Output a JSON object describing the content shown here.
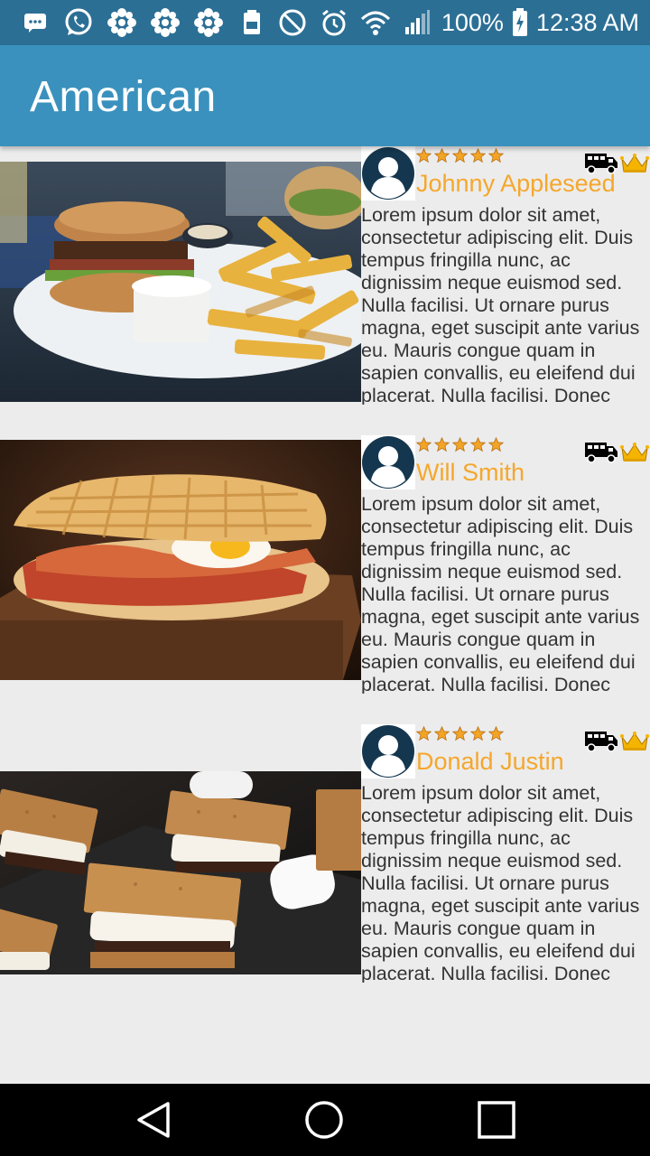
{
  "status_bar": {
    "battery_percent": "100%",
    "time": "12:38 AM",
    "left_icons": [
      "message-icon",
      "whatsapp-icon",
      "cbc-icon",
      "cbc-icon",
      "cbc-icon",
      "nfc-icon"
    ],
    "right_icons": [
      "do-not-disturb-icon",
      "alarm-icon",
      "wifi-icon",
      "signal-icon",
      "battery-charging-icon"
    ]
  },
  "app_bar": {
    "title": "American"
  },
  "accent_colors": {
    "status_bar": "#2c6f95",
    "app_bar": "#3a91bd",
    "name_text": "#f5a72c",
    "avatar": "#14374f"
  },
  "items": [
    {
      "name": "Johnny Appleseed",
      "rating": 5,
      "image": "burger-and-fries",
      "description": "Lorem ipsum dolor sit amet, consectetur adipiscing elit. Duis tempus fringilla nunc, ac dignissim neque euismod sed. Nulla facilisi. Ut ornare purus magna, eget suscipit ante varius eu. Mauris congue quam in sapien convallis, eu eleifend dui placerat. Nulla facilisi. Donec"
    },
    {
      "name": "Will Smith",
      "rating": 5,
      "image": "waffle-sandwich",
      "description": "Lorem ipsum dolor sit amet, consectetur adipiscing elit. Duis tempus fringilla nunc, ac dignissim neque euismod sed. Nulla facilisi. Ut ornare purus magna, eget suscipit ante varius eu. Mauris congue quam in sapien convallis, eu eleifend dui placerat. Nulla facilisi. Donec"
    },
    {
      "name": "Donald Justin",
      "rating": 5,
      "image": "smores",
      "description": "Lorem ipsum dolor sit amet, consectetur adipiscing elit. Duis tempus fringilla nunc, ac dignissim neque euismod sed. Nulla facilisi. Ut ornare purus magna, eget suscipit ante varius eu. Mauris congue quam in sapien convallis, eu eleifend dui placerat. Nulla facilisi. Donec"
    }
  ],
  "nav_bar": {
    "buttons": [
      "back-icon",
      "home-icon",
      "recents-icon"
    ]
  }
}
